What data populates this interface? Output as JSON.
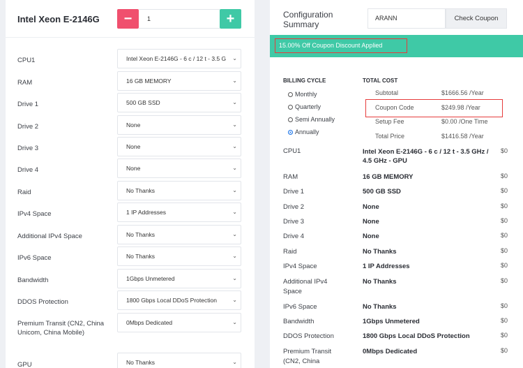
{
  "product": {
    "title": "Intel Xeon E-2146G",
    "qty": "1",
    "minus": "−",
    "plus": "+"
  },
  "options": [
    {
      "label": "CPU1",
      "value": "Intel Xeon E-2146G - 6 c / 12 t - 3.5 G"
    },
    {
      "label": "RAM",
      "value": "16 GB MEMORY"
    },
    {
      "label": "Drive 1",
      "value": "500 GB SSD"
    },
    {
      "label": "Drive 2",
      "value": "None"
    },
    {
      "label": "Drive 3",
      "value": "None"
    },
    {
      "label": "Drive 4",
      "value": "None"
    },
    {
      "label": "Raid",
      "value": "No Thanks"
    },
    {
      "label": "IPv4 Space",
      "value": "1 IP Addresses"
    },
    {
      "label": "Additional IPv4 Space",
      "value": "No Thanks"
    },
    {
      "label": "IPv6 Space",
      "value": "No Thanks"
    },
    {
      "label": "Bandwidth",
      "value": "1Gbps Unmetered"
    },
    {
      "label": "DDOS Protection",
      "value": "1800 Gbps Local DDoS Protection"
    },
    {
      "label": "Premium Transit (CN2, China Unicom, China Mobile)",
      "value": "0Mbps Dedicated"
    },
    {
      "label": "GPU",
      "value": "No Thanks"
    }
  ],
  "summary": {
    "title": "Configuration Summary",
    "coupon_code": "ARANN",
    "check_coupon": "Check Coupon",
    "banner": "15.00% Off Coupon Discount Applied",
    "billing_cycle_header": "BILLING CYCLE",
    "total_cost_header": "TOTAL COST",
    "cycles": [
      {
        "label": "Monthly",
        "selected": false
      },
      {
        "label": "Quarterly",
        "selected": false
      },
      {
        "label": "Semi Annually",
        "selected": false
      },
      {
        "label": "Annually",
        "selected": true
      }
    ],
    "costs": [
      {
        "label": "Subtotal",
        "value": "$1666.56 /Year"
      },
      {
        "label": "Coupon Code",
        "value": "$249.98 /Year"
      },
      {
        "label": "Setup Fee",
        "value": "$0.00 /One Time"
      },
      {
        "label": "Total Price",
        "value": "$1416.58 /Year"
      }
    ],
    "rows": [
      {
        "label": "CPU1",
        "value": "Intel Xeon E-2146G - 6 c / 12 t - 3.5 GHz / 4.5 GHz - GPU",
        "price": "$0"
      },
      {
        "label": "RAM",
        "value": "16 GB MEMORY",
        "price": "$0"
      },
      {
        "label": "Drive 1",
        "value": "500 GB SSD",
        "price": "$0"
      },
      {
        "label": "Drive 2",
        "value": "None",
        "price": "$0"
      },
      {
        "label": "Drive 3",
        "value": "None",
        "price": "$0"
      },
      {
        "label": "Drive 4",
        "value": "None",
        "price": "$0"
      },
      {
        "label": "Raid",
        "value": "No Thanks",
        "price": "$0"
      },
      {
        "label": "IPv4 Space",
        "value": "1 IP Addresses",
        "price": "$0"
      },
      {
        "label": "Additional IPv4 Space",
        "value": "No Thanks",
        "price": "$0"
      },
      {
        "label": "IPv6 Space",
        "value": "No Thanks",
        "price": "$0"
      },
      {
        "label": "Bandwidth",
        "value": "1Gbps Unmetered",
        "price": "$0"
      },
      {
        "label": "DDOS Protection",
        "value": "1800 Gbps Local DDoS Protection",
        "price": "$0"
      },
      {
        "label": "Premium Transit (CN2, China",
        "value": "0Mbps Dedicated",
        "price": "$0"
      }
    ]
  }
}
